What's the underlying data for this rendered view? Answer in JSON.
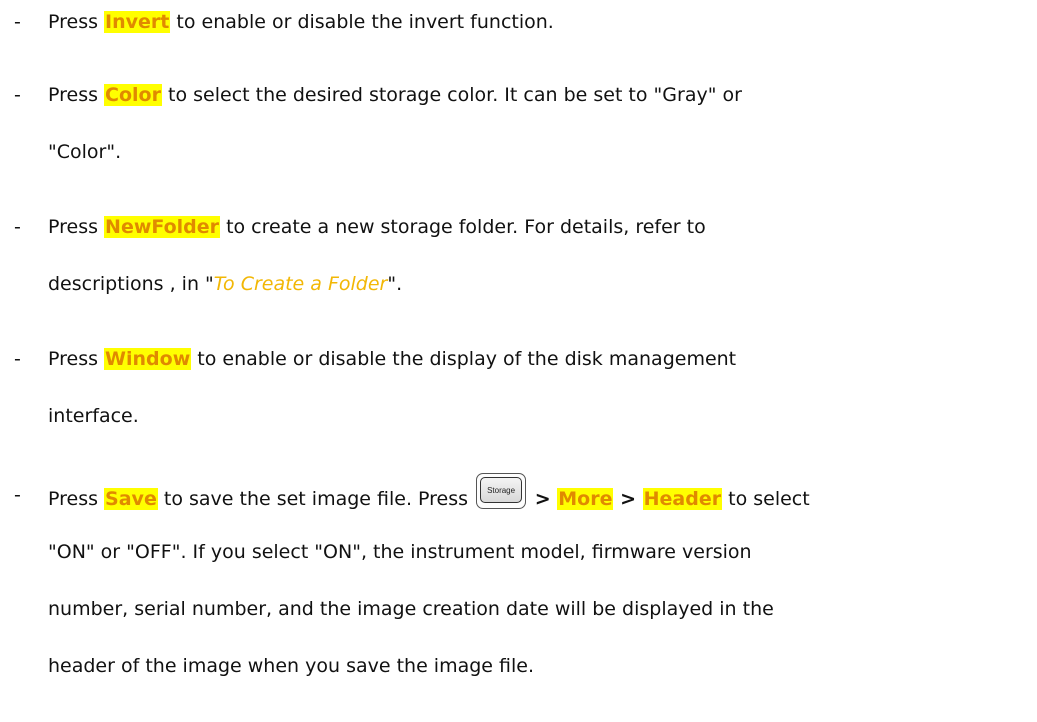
{
  "bullets": {
    "invert": {
      "dash": "-",
      "pre": "Press ",
      "key": "Invert",
      "post": " to enable or disable the invert function."
    },
    "color": {
      "dash": "-",
      "pre": "Press ",
      "key": "Color",
      "post_line1": " to select the desired storage color. It can be set to \"Gray\" or",
      "line2": "\"Color\"."
    },
    "newfolder": {
      "dash": "-",
      "pre": "Press ",
      "key": "NewFolder",
      "post_line1": " to create a new storage folder. For details, refer to",
      "line2_pre": "descriptions , in \"",
      "link": "To Create a Folder",
      "line2_post": "\"."
    },
    "window": {
      "dash": "-",
      "pre": "Press ",
      "key": "Window",
      "post_line1": " to enable or disable the display of the disk management",
      "line2": "interface."
    },
    "save": {
      "dash": "-",
      "pre": "Press ",
      "key": "Save",
      "mid": " to save the set image file. Press ",
      "button_label": "Storage",
      "sep1": " > ",
      "key_more": "More",
      "sep2": " > ",
      "key_header": "Header",
      "post_line1": " to select",
      "line2": "\"ON\" or \"OFF\". If you select \"ON\", the instrument model, firmware version",
      "line3": "number, serial number, and the image creation date will be displayed in the",
      "line4": "header of the image when you save the image file."
    }
  }
}
